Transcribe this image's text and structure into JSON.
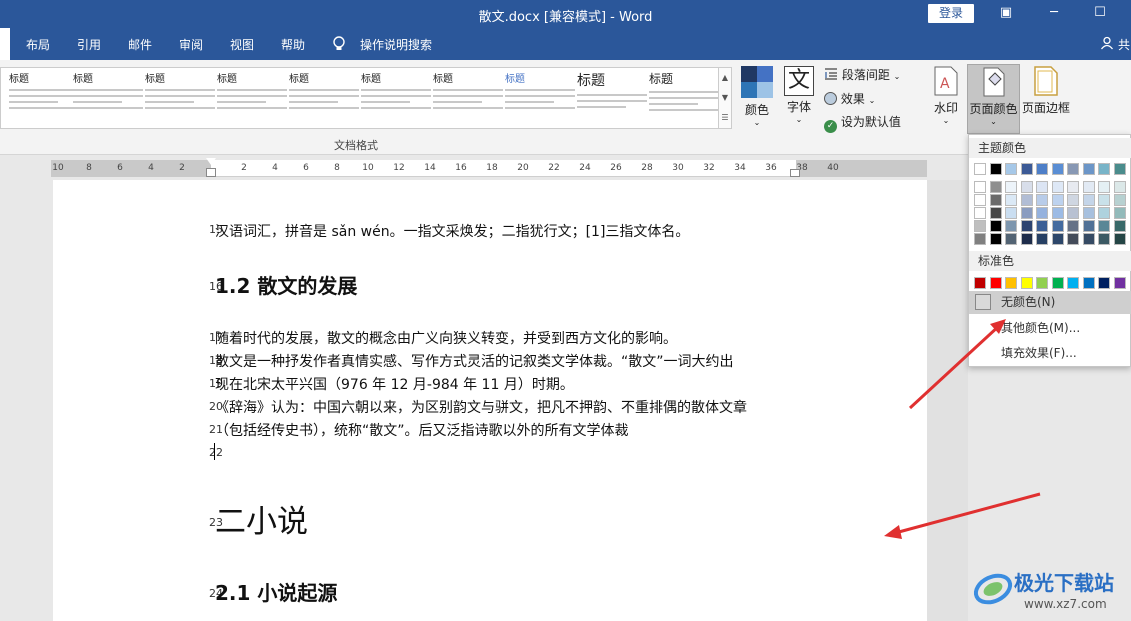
{
  "title": "散文.docx [兼容模式]  -  Word",
  "login_label": "登录",
  "menu": [
    "布局",
    "引用",
    "邮件",
    "审阅",
    "视图",
    "帮助",
    "操作说明搜索"
  ],
  "share_label": "共",
  "styles": [
    {
      "h": "标题"
    },
    {
      "h": "标题"
    },
    {
      "h": "标题"
    },
    {
      "h": "标题"
    },
    {
      "h": "标题"
    },
    {
      "h": "标题"
    },
    {
      "h": "标题"
    },
    {
      "h": "标题"
    },
    {
      "h": "标题"
    },
    {
      "h": "标题"
    }
  ],
  "ribbon": {
    "color": "颜色",
    "font": "字体",
    "font_glyph": "文",
    "para_spacing": "段落间距",
    "effects": "效果",
    "set_default": "设为默认值",
    "watermark": "水印",
    "page_color": "页面颜色",
    "page_border": "页面边框",
    "group_label": "文档格式"
  },
  "ruler": [
    "10",
    "8",
    "6",
    "4",
    "2",
    "2",
    "4",
    "6",
    "8",
    "10",
    "12",
    "14",
    "16",
    "18",
    "20",
    "22",
    "24",
    "26",
    "28",
    "30",
    "32",
    "34",
    "36",
    "38",
    "40"
  ],
  "doc": {
    "lines": [
      {
        "n": "15",
        "t": "汉语词汇，拼音是 sǎn wén。一指文采焕发；二指犹行文；[1]三指文体名。",
        "cls": ""
      },
      {
        "n": "16",
        "t": "1.2 散文的发展",
        "cls": "h2"
      },
      {
        "n": "17",
        "t": "随着时代的发展，散文的概念由广义向狭义转变，并受到西方文化的影响。",
        "cls": ""
      },
      {
        "n": "18",
        "t": "散文是一种抒发作者真情实感、写作方式灵活的记叙类文学体裁。“散文”一词大约出",
        "cls": ""
      },
      {
        "n": "19",
        "t": "现在北宋太平兴国（976 年 12 月-984 年 11 月）时期。",
        "cls": ""
      },
      {
        "n": "20",
        "t": "《辞海》认为：中国六朝以来，为区别韵文与骈文，把凡不押韵、不重排偶的散体文章",
        "cls": ""
      },
      {
        "n": "21",
        "t": "（包括经传史书），统称“散文”。后又泛指诗歌以外的所有文学体裁",
        "cls": ""
      },
      {
        "n": "22",
        "t": "",
        "cls": ""
      },
      {
        "n": "23",
        "t": "二小说",
        "cls": "h1"
      },
      {
        "n": "24",
        "t": "2.1 小说起源",
        "cls": "h2"
      }
    ]
  },
  "dropdown": {
    "theme_colors": "主题颜色",
    "standard_colors": "标准色",
    "no_color": "无颜色(N)",
    "more_colors": "其他颜色(M)...",
    "fill_effects": "填充效果(F)..."
  },
  "theme_top": [
    "#ffffff",
    "#000000",
    "#e7e6e6",
    "#44546a",
    "#4472c4",
    "#ed7d31",
    "#a5a5a5",
    "#ffc000",
    "#5b9bd5",
    "#70ad47"
  ],
  "theme_top_actual": [
    "#ffffff",
    "#000000",
    "#a6c8e8",
    "#3c5a96",
    "#4e7fc8",
    "#5a8ed4",
    "#8898b4",
    "#6c96c8",
    "#78b4c8",
    "#4a8c8c"
  ],
  "standard": [
    "#c00000",
    "#ff0000",
    "#ffc000",
    "#ffff00",
    "#92d050",
    "#00b050",
    "#00b0f0",
    "#0070c0",
    "#002060",
    "#7030a0"
  ],
  "watermark_text": "极光下载站",
  "watermark_url": "www.xz7.com"
}
